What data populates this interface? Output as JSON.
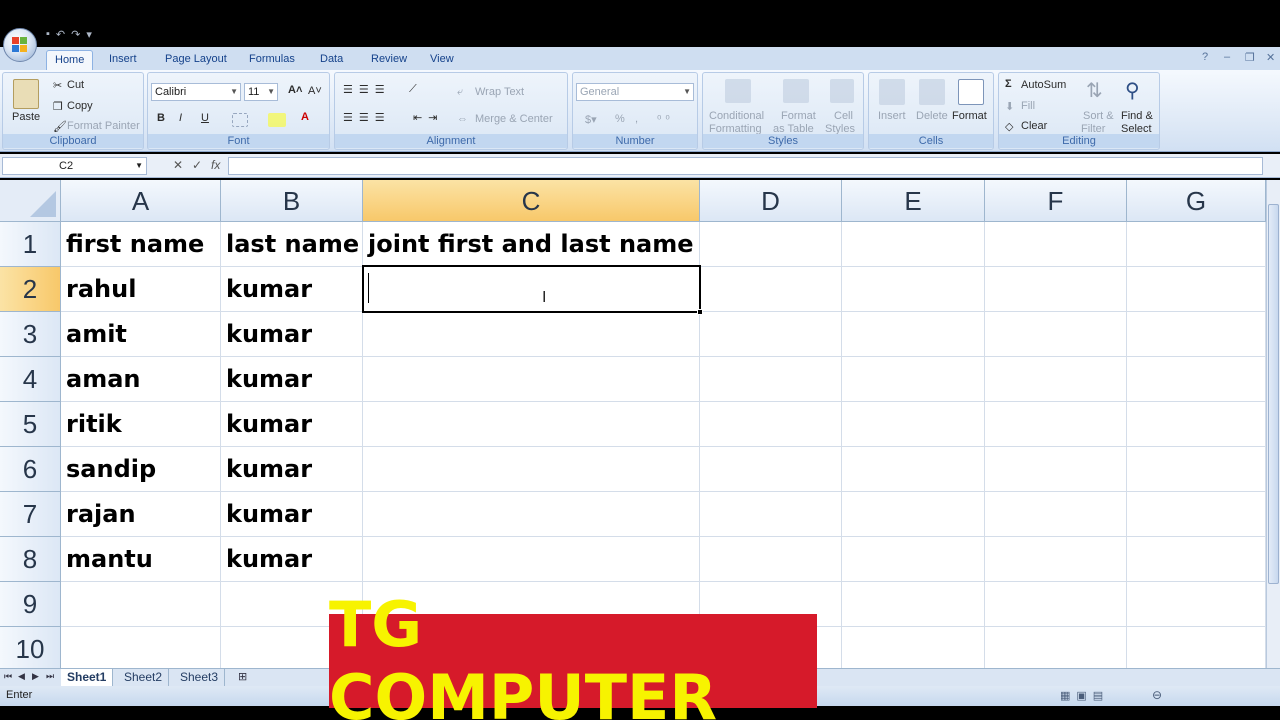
{
  "ribbon": {
    "tabs": [
      "Home",
      "Insert",
      "Page Layout",
      "Formulas",
      "Data",
      "Review",
      "View"
    ],
    "active_tab": "Home",
    "clipboard": {
      "paste": "Paste",
      "cut": "Cut",
      "copy": "Copy",
      "format_painter": "Format Painter",
      "label": "Clipboard"
    },
    "font": {
      "name": "Calibri",
      "size": "11",
      "bold": "B",
      "italic": "I",
      "underline": "U",
      "label": "Font"
    },
    "alignment": {
      "wrap_text": "Wrap Text",
      "merge_center": "Merge & Center",
      "label": "Alignment"
    },
    "number": {
      "format": "General",
      "percent": "%",
      "label": "Number"
    },
    "styles": {
      "conditional": "Conditional",
      "conditional2": "Formatting",
      "format_as": "Format",
      "format_as2": "as Table",
      "cell": "Cell",
      "cell2": "Styles",
      "label": "Styles"
    },
    "cells": {
      "insert": "Insert",
      "delete": "Delete",
      "format": "Format",
      "label": "Cells"
    },
    "editing": {
      "autosum": "AutoSum",
      "fill": "Fill",
      "clear": "Clear",
      "sort": "Sort &",
      "sort2": "Filter",
      "find": "Find &",
      "find2": "Select",
      "label": "Editing"
    }
  },
  "formula_bar": {
    "name_box": "C2",
    "fx": "fx",
    "cancel": "✕",
    "enter": "✓",
    "value": ""
  },
  "columns": [
    "A",
    "B",
    "C",
    "D",
    "E",
    "F",
    "G"
  ],
  "selected_column": "C",
  "rows": [
    "1",
    "2",
    "3",
    "4",
    "5",
    "6",
    "7",
    "8",
    "9",
    "10"
  ],
  "selected_row": "2",
  "cells": [
    [
      "first name",
      "last name",
      "joint first and last name"
    ],
    [
      "rahul",
      "kumar",
      ""
    ],
    [
      "amit",
      "kumar",
      ""
    ],
    [
      "aman",
      "kumar",
      ""
    ],
    [
      "ritik",
      "kumar",
      ""
    ],
    [
      "sandip",
      "kumar",
      ""
    ],
    [
      "rajan",
      "kumar",
      ""
    ],
    [
      "mantu",
      "kumar",
      ""
    ]
  ],
  "sheets": [
    "Sheet1",
    "Sheet2",
    "Sheet3"
  ],
  "active_sheet": "Sheet1",
  "status": "Enter",
  "banner": "TG COMPUTER",
  "colors": {
    "banner_bg": "#d61a2a",
    "banner_text": "#f7f300",
    "header_selected": "#f8c86a",
    "ribbon_text": "#15428b"
  }
}
